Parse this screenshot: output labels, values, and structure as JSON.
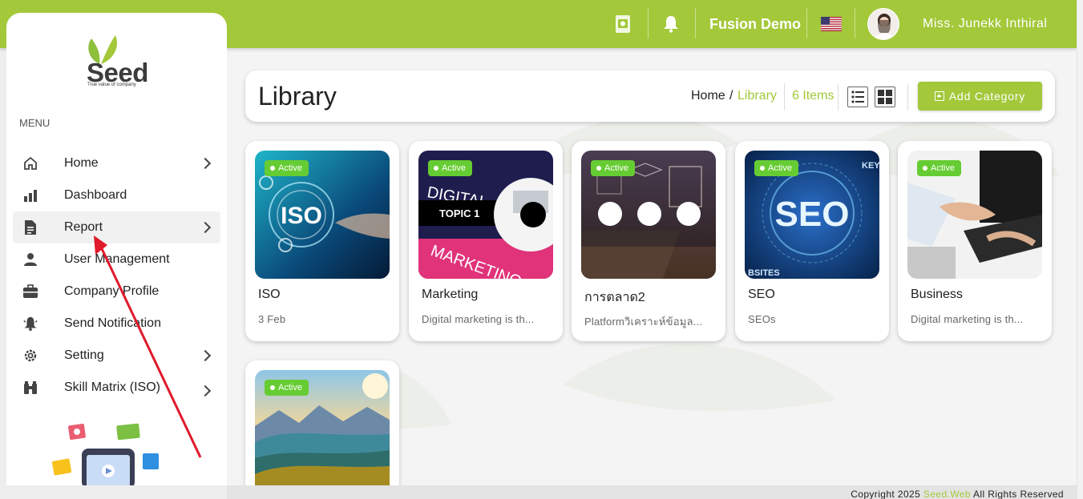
{
  "colors": {
    "brand": "#a3c83a",
    "active_badge": "#66cc33",
    "annotation_arrow": "#e0192b"
  },
  "topbar": {
    "company": "Fusion Demo",
    "user_name": "Miss. Junekk Inthiral",
    "icons": [
      "book-icon",
      "bell-icon",
      "us-flag-icon",
      "user-avatar"
    ]
  },
  "sidebar": {
    "logo_text": "Seed",
    "logo_tagline": "True value of company",
    "menu_label": "MENU",
    "items": [
      {
        "label": "Home",
        "icon": "home-icon",
        "has_submenu": true
      },
      {
        "label": "Dashboard",
        "icon": "bar-chart-icon",
        "has_submenu": false
      },
      {
        "label": "Report",
        "icon": "document-icon",
        "has_submenu": true,
        "active": true
      },
      {
        "label": "User Management",
        "icon": "user-icon",
        "has_submenu": false
      },
      {
        "label": "Company Profile",
        "icon": "briefcase-icon",
        "has_submenu": false
      },
      {
        "label": "Send Notification",
        "icon": "bell-alert-icon",
        "has_submenu": false
      },
      {
        "label": "Setting",
        "icon": "gear-icon",
        "has_submenu": true
      },
      {
        "label": "Skill Matrix (ISO)",
        "icon": "binoculars-icon",
        "has_submenu": true
      }
    ]
  },
  "page": {
    "title": "Library",
    "breadcrumb_home": "Home",
    "breadcrumb_sep": "/",
    "breadcrumb_current": "Library",
    "items_count": "6 Items",
    "add_button": "Add Category"
  },
  "cards": [
    {
      "status": "Active",
      "name": "ISO",
      "desc": "3 Feb",
      "thumb": "iso-thumbnail",
      "thumb_text": "ISO"
    },
    {
      "status": "Active",
      "name": "Marketing",
      "desc": "Digital marketing is th...",
      "thumb": "digital-marketing-thumbnail",
      "thumb_text": "TOPIC 1"
    },
    {
      "status": "Active",
      "name": "การตลาด2",
      "desc": "Platformวิเคราะห์ข้อมูล...",
      "thumb": "laptop-thumbnail"
    },
    {
      "status": "Active",
      "name": "SEO",
      "desc": "SEOs",
      "thumb": "seo-thumbnail",
      "thumb_text": "SEO"
    },
    {
      "status": "Active",
      "name": "Business",
      "desc": "Digital marketing is th...",
      "thumb": "business-thumbnail"
    },
    {
      "status": "Active",
      "name": "",
      "desc": "",
      "thumb": "landscape-thumbnail"
    }
  ],
  "footer": {
    "prefix": "Copyright 2025 ",
    "brand": "Seed.Web",
    "suffix": " All Rights Reserved"
  }
}
